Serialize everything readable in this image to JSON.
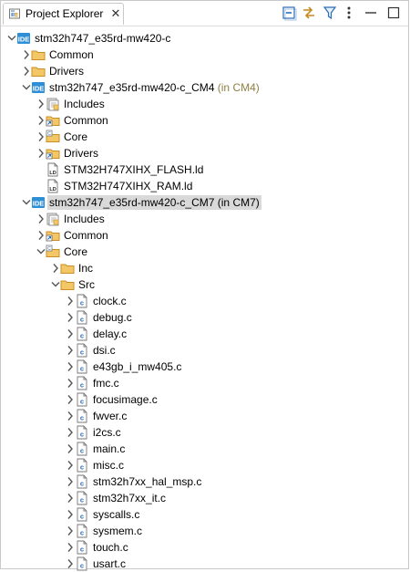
{
  "tab": {
    "title": "Project Explorer",
    "close": "✕"
  },
  "toolbar": {
    "collapse_all": "collapse-all-icon",
    "link_editor": "link-with-editor-icon",
    "filter": "filter-icon",
    "view_menu": "view-menu-icon",
    "minimize": "minimize-icon",
    "maximize": "maximize-icon"
  },
  "tree": [
    {
      "label": "stm32h747_e35rd-mw420-c",
      "icon": "project",
      "level": 0,
      "arrow": "down"
    },
    {
      "label": "Common",
      "icon": "folder",
      "level": 1,
      "arrow": "right"
    },
    {
      "label": "Drivers",
      "icon": "folder",
      "level": 1,
      "arrow": "right"
    },
    {
      "label": "stm32h747_e35rd-mw420-c_CM4",
      "suffix": " (in CM4)",
      "icon": "project",
      "level": 1,
      "arrow": "down"
    },
    {
      "label": "Includes",
      "icon": "includes",
      "level": 2,
      "arrow": "right"
    },
    {
      "label": "Common",
      "icon": "linked-folder",
      "level": 2,
      "arrow": "right"
    },
    {
      "label": "Core",
      "icon": "src-folder",
      "level": 2,
      "arrow": "right"
    },
    {
      "label": "Drivers",
      "icon": "linked-folder",
      "level": 2,
      "arrow": "right"
    },
    {
      "label": "STM32H747XIHX_FLASH.ld",
      "icon": "ld-file",
      "level": 2,
      "arrow": "none"
    },
    {
      "label": "STM32H747XIHX_RAM.ld",
      "icon": "ld-file",
      "level": 2,
      "arrow": "none"
    },
    {
      "label": "stm32h747_e35rd-mw420-c_CM7",
      "suffix": " (in CM7)",
      "icon": "project",
      "level": 1,
      "arrow": "down",
      "selected": true
    },
    {
      "label": "Includes",
      "icon": "includes",
      "level": 2,
      "arrow": "right"
    },
    {
      "label": "Common",
      "icon": "linked-folder",
      "level": 2,
      "arrow": "right"
    },
    {
      "label": "Core",
      "icon": "src-folder",
      "level": 2,
      "arrow": "down"
    },
    {
      "label": "Inc",
      "icon": "folder",
      "level": 3,
      "arrow": "right"
    },
    {
      "label": "Src",
      "icon": "folder",
      "level": 3,
      "arrow": "down"
    },
    {
      "label": "clock.c",
      "icon": "c-file",
      "level": 4,
      "arrow": "right"
    },
    {
      "label": "debug.c",
      "icon": "c-file",
      "level": 4,
      "arrow": "right"
    },
    {
      "label": "delay.c",
      "icon": "c-file",
      "level": 4,
      "arrow": "right"
    },
    {
      "label": "dsi.c",
      "icon": "c-file",
      "level": 4,
      "arrow": "right"
    },
    {
      "label": "e43gb_i_mw405.c",
      "icon": "c-file",
      "level": 4,
      "arrow": "right"
    },
    {
      "label": "fmc.c",
      "icon": "c-file",
      "level": 4,
      "arrow": "right"
    },
    {
      "label": "focusimage.c",
      "icon": "c-file",
      "level": 4,
      "arrow": "right"
    },
    {
      "label": "fwver.c",
      "icon": "c-file",
      "level": 4,
      "arrow": "right"
    },
    {
      "label": "i2cs.c",
      "icon": "c-file",
      "level": 4,
      "arrow": "right"
    },
    {
      "label": "main.c",
      "icon": "c-file",
      "level": 4,
      "arrow": "right"
    },
    {
      "label": "misc.c",
      "icon": "c-file",
      "level": 4,
      "arrow": "right"
    },
    {
      "label": "stm32h7xx_hal_msp.c",
      "icon": "c-file",
      "level": 4,
      "arrow": "right"
    },
    {
      "label": "stm32h7xx_it.c",
      "icon": "c-file",
      "level": 4,
      "arrow": "right"
    },
    {
      "label": "syscalls.c",
      "icon": "c-file",
      "level": 4,
      "arrow": "right"
    },
    {
      "label": "sysmem.c",
      "icon": "c-file",
      "level": 4,
      "arrow": "right"
    },
    {
      "label": "touch.c",
      "icon": "c-file",
      "level": 4,
      "arrow": "right"
    },
    {
      "label": "usart.c",
      "icon": "c-file",
      "level": 4,
      "arrow": "right"
    }
  ],
  "colors": {
    "project_icon": "#2f8fd6",
    "folder": "#e8b54a",
    "selection": "#d9d9d9",
    "suffix": "#8f8042"
  }
}
